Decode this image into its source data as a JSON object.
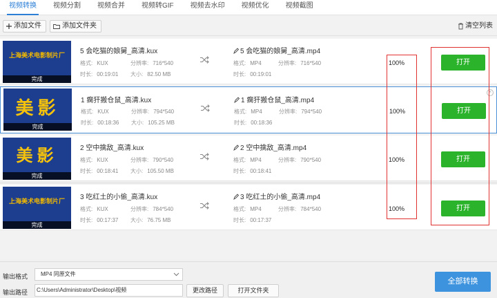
{
  "tabs": [
    {
      "label": "视频转换",
      "active": true
    },
    {
      "label": "视频分割",
      "active": false
    },
    {
      "label": "视频合并",
      "active": false
    },
    {
      "label": "视频转GIF",
      "active": false
    },
    {
      "label": "视频去水印",
      "active": false
    },
    {
      "label": "视频优化",
      "active": false
    },
    {
      "label": "视频截图",
      "active": false
    }
  ],
  "toolbar": {
    "add_file": "添加文件",
    "add_folder": "添加文件夹",
    "clear_list": "清空列表"
  },
  "labels": {
    "format": "格式:",
    "resolution": "分辨率:",
    "duration": "时长:",
    "size": "大小:"
  },
  "rows": [
    {
      "thumb_text": "上海美术电影制片厂",
      "thumb_style": "small",
      "status": "完成",
      "src_name": "5 会吃猫的娘舅_高清.kux",
      "src_format": "KUX",
      "src_resolution": "716*540",
      "src_duration": "00:19:01",
      "src_size": "82.50 MB",
      "dst_name": "5 会吃猫的娘舅_高清.mp4",
      "dst_format": "MP4",
      "dst_resolution": "716*540",
      "dst_duration": "00:19:01",
      "progress": "100%",
      "open_label": "打开"
    },
    {
      "thumb_text": "美影",
      "thumb_style": "big",
      "status": "完成",
      "src_name": "1 瘸犴搬仓鼠_高清.kux",
      "src_format": "KUX",
      "src_resolution": "794*540",
      "src_duration": "00:18:36",
      "src_size": "105.25 MB",
      "dst_name": "1 瘸犴搬仓鼠_高清.mp4",
      "dst_format": "MP4",
      "dst_resolution": "794*540",
      "dst_duration": "00:18:36",
      "progress": "100%",
      "open_label": "打开"
    },
    {
      "thumb_text": "美影",
      "thumb_style": "big",
      "status": "完成",
      "src_name": "2 空中擒敌_高清.kux",
      "src_format": "KUX",
      "src_resolution": "790*540",
      "src_duration": "00:18:41",
      "src_size": "105.50 MB",
      "dst_name": "2 空中擒敌_高清.mp4",
      "dst_format": "MP4",
      "dst_resolution": "790*540",
      "dst_duration": "00:18:41",
      "progress": "100%",
      "open_label": "打开"
    },
    {
      "thumb_text": "上海美术电影制片厂",
      "thumb_style": "small",
      "status": "完成",
      "src_name": "3 吃红土的小偷_高清.kux",
      "src_format": "KUX",
      "src_resolution": "784*540",
      "src_duration": "00:17:37",
      "src_size": "76.75 MB",
      "dst_name": "3 吃红土的小偷_高清.mp4",
      "dst_format": "MP4",
      "dst_resolution": "784*540",
      "dst_duration": "00:17:37",
      "progress": "100%",
      "open_label": "打开"
    }
  ],
  "bottom": {
    "format_label": "输出格式",
    "format_value": "MP4 同原文件",
    "path_label": "输出路径",
    "path_value": "C:\\Users\\Administrator\\Desktop\\视频",
    "change_path": "更改路径",
    "open_folder": "打开文件夹",
    "convert_all": "全部转换"
  },
  "colors": {
    "accent": "#2b7fd6",
    "open_button": "#2bb32b",
    "convert_button": "#3e93df",
    "annotation_box": "#e03030",
    "thumb_bg": "#1d3d8f",
    "thumb_text": "#f2c20a"
  },
  "icons": {
    "add_file": "plus-icon",
    "add_folder": "folder-icon",
    "clear_list": "trash-icon",
    "convert_arrow": "shuffle-icon",
    "output_file": "pencil-icon",
    "dropdown": "chevron-down-icon"
  }
}
